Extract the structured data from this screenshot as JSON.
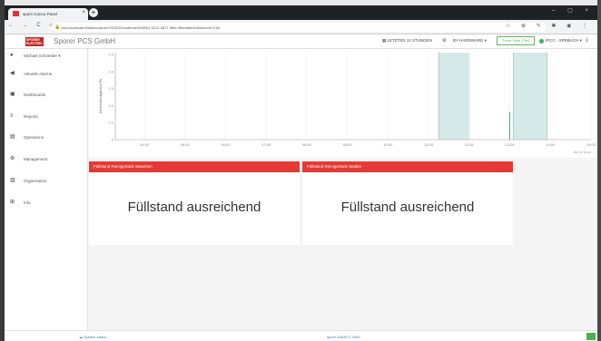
{
  "browser": {
    "tab_title": "spom Cuncu Panel",
    "url": "cloud.sumcast.lt/dashboard/cTNS915/sunfence/DNR64-3212-4617-9f8e-9fbe4fa6d1d6ab/cust?10k",
    "nav_icons": "← → C ⌂",
    "right_icons": "☆ ⊕ ✎ ✱ ◉ ⋮"
  },
  "header": {
    "logo_text": "SPORER ELECTRIC",
    "brand": "Sporer PCS GmbH",
    "time_range": "LETZTEN 12 STUNDEN",
    "hardware": "BY HARDWARE ▾",
    "trend": "Trend View (Tile)",
    "user": "IPCC - SPEBACH ▾",
    "colors": {
      "status_green": "#4caf50",
      "brand_red": "#c62828"
    }
  },
  "sidebar": {
    "items": [
      {
        "icon": "user-icon",
        "label": "Michael Schneider ▾"
      },
      {
        "icon": "megaphone-icon",
        "label": "Aktuelle Alarme"
      },
      {
        "icon": "dashboard-icon",
        "label": "Dashboards"
      },
      {
        "icon": "reports-icon",
        "label": "Reports"
      },
      {
        "icon": "operations-icon",
        "label": "Operations"
      },
      {
        "icon": "management-icon",
        "label": "Management"
      },
      {
        "icon": "organisation-icon",
        "label": "Organisation"
      },
      {
        "icon": "info-icon",
        "label": "Info"
      }
    ]
  },
  "chart_data": {
    "type": "line",
    "ylabel": "Geschwindigkeit m³/h",
    "y_ticks": [
      "0.3",
      "0.4",
      "0.3",
      "0.2",
      "0.1",
      "0"
    ],
    "x_ticks": [
      "04:00",
      "05:00",
      "06:00",
      "07:00",
      "08:00",
      "09:00",
      "10:00",
      "11:00",
      "12:00",
      "13:00",
      "14:00",
      "15:00"
    ],
    "corner_note": "Alt ex hour",
    "highlight_ranges": [
      [
        "11:15",
        "12:00"
      ],
      [
        "13:05",
        "13:55"
      ]
    ],
    "event_x": "13:00",
    "event_value": 0.16,
    "highlight_color": "#d6e9e9"
  },
  "cards": [
    {
      "title": "Füllstand Reinigertank Waschen",
      "value": "Füllstand ausreichend"
    },
    {
      "title": "Füllstand Reinigertank Spülen",
      "value": "Füllstand ausreichend"
    }
  ],
  "footer": {
    "status_link": "System status",
    "copyright": "spom GmbH © 2020"
  }
}
